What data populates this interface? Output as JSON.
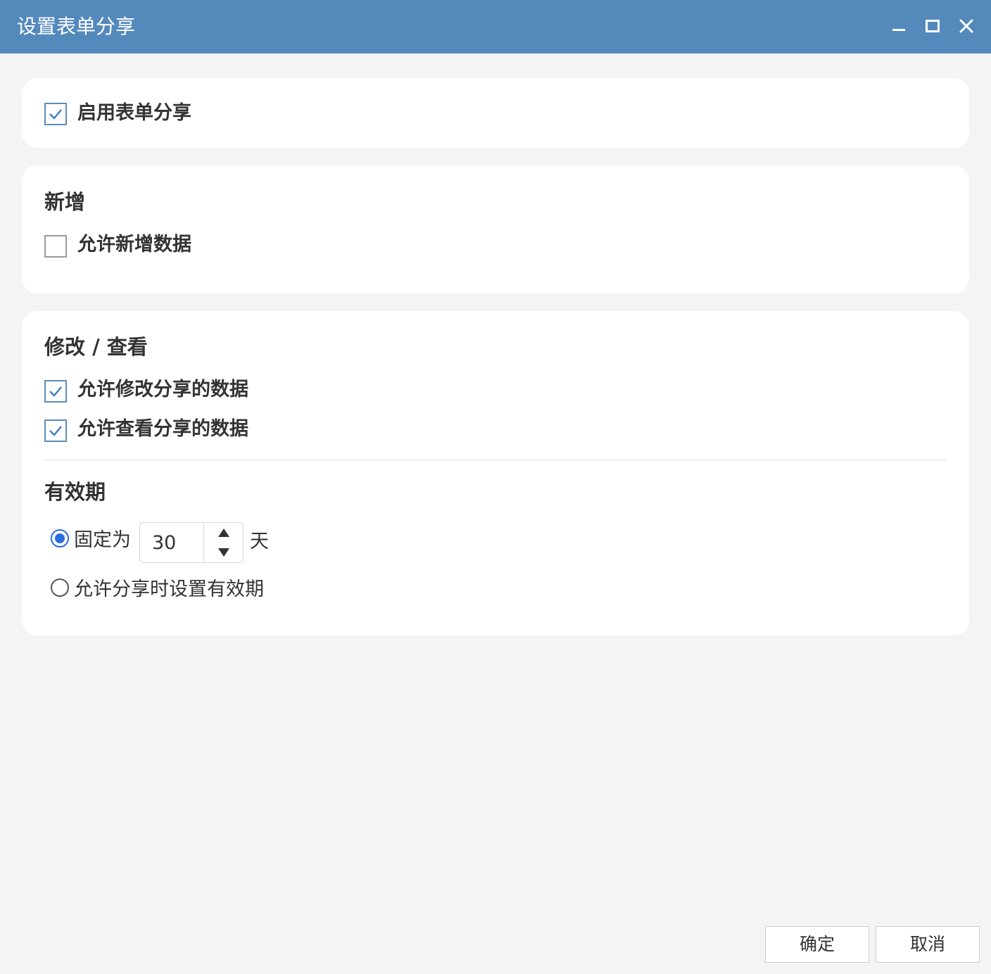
{
  "window": {
    "title": "设置表单分享",
    "controls": [
      "minimize-icon",
      "maximize-icon",
      "close-icon"
    ]
  },
  "share": {
    "enable_label": "启用表单分享",
    "enabled": true
  },
  "add_section": {
    "title": "新增",
    "allow_add_label": "允许新增数据",
    "allow_add": false
  },
  "edit_section": {
    "title": "修改 / 查看",
    "allow_edit_label": "允许修改分享的数据",
    "allow_edit": true,
    "allow_view_label": "允许查看分享的数据",
    "allow_view": true
  },
  "validity": {
    "title": "有效期",
    "fixed_label": "固定为",
    "fixed_selected": true,
    "days_value": "30",
    "days_unit": "天",
    "custom_label": "允许分享时设置有效期",
    "custom_selected": false
  },
  "footer": {
    "ok_label": "确定",
    "cancel_label": "取消"
  },
  "colors": {
    "titlebar": "#5489bc",
    "checkbox_checked": "#5a8bbd",
    "radio_checked": "#2a6de0"
  }
}
